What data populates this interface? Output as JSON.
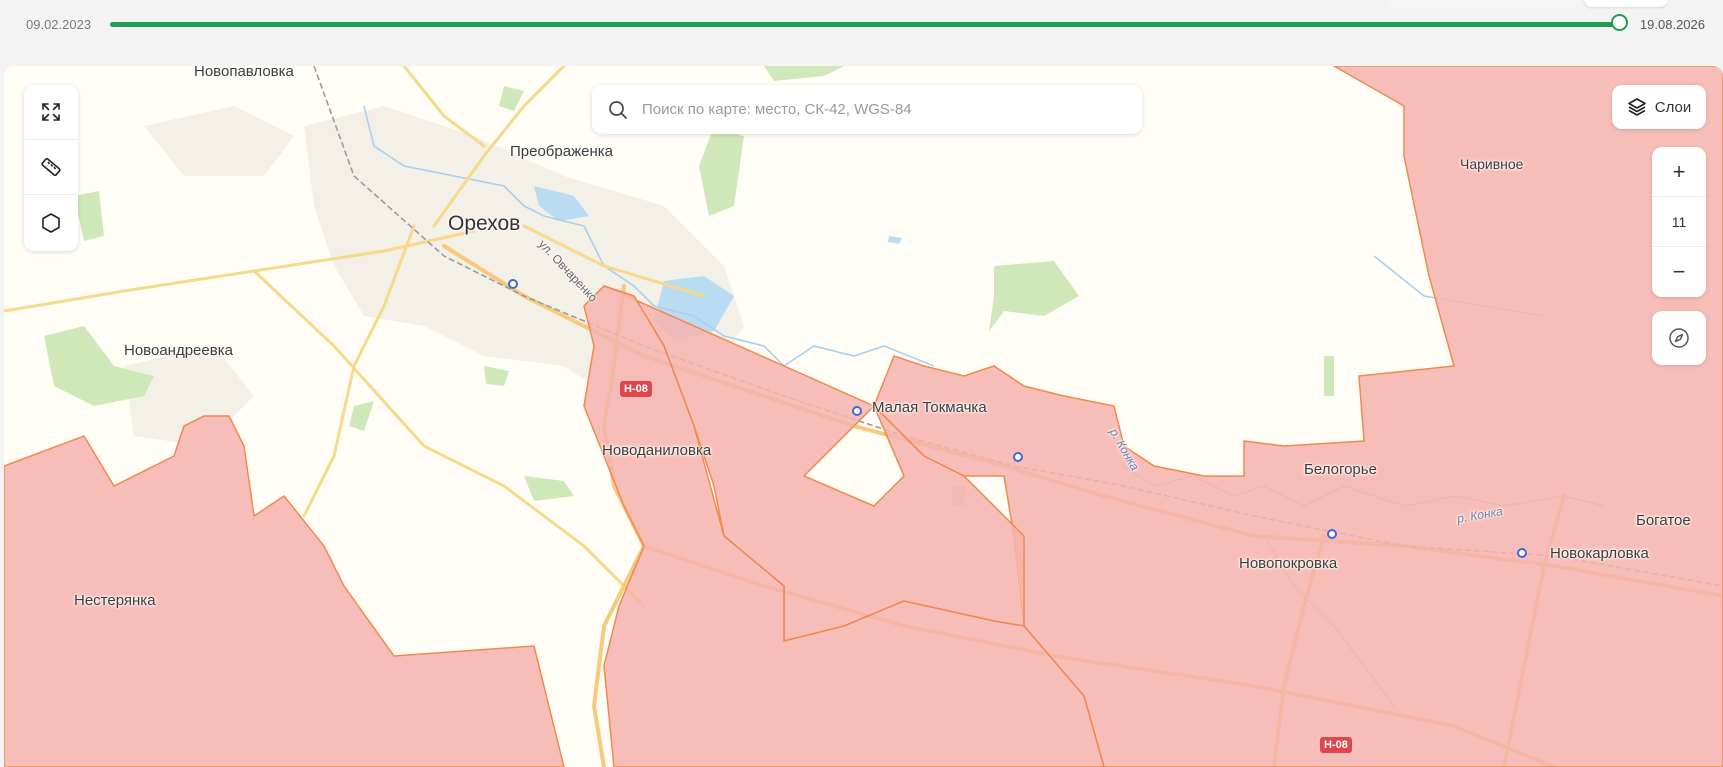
{
  "timeline": {
    "start_date": "09.02.2023",
    "end_date": "19.08.2026",
    "progress": 1.0,
    "accent_color": "#1f9d55"
  },
  "search": {
    "placeholder": "Поиск по карте: место, СК-42, WGS-84"
  },
  "layers": {
    "label": "Слои"
  },
  "zoom": {
    "level": "11",
    "plus": "+",
    "minus": "−"
  },
  "tools": [
    {
      "icon": "expand-icon"
    },
    {
      "icon": "ruler-icon"
    },
    {
      "icon": "polygon-icon"
    }
  ],
  "colors": {
    "occupied_fill": "#f6b3ae",
    "occupied_border": "#f08a4b",
    "map_background": "#fffdf6",
    "road_major": "#f8d98a",
    "river": "#a8d0ee"
  },
  "map_labels": {
    "novopavlovka": "Новопавловка",
    "preobrazhenka": "Преображенка",
    "orekhov": "Орехов",
    "ovcharenko_st": "ул. Овчаренко",
    "novoandreevka": "Новоандреевка",
    "malaya_tokmachka": "Малая Токмачка",
    "novodanilovka": "Новоданиловка",
    "nesteryanka": "Нестерянка",
    "charivnoe": "Чаривное",
    "belogorye": "Белогорье",
    "bogatoe": "Богатое",
    "novopokrovka": "Новопокровка",
    "novokarlovka": "Новокарловка",
    "river_konka_1": "р. Конка",
    "river_konka_2": "р. Конка",
    "road_h08_1": "Н-08",
    "road_h08_2": "Н-08"
  }
}
